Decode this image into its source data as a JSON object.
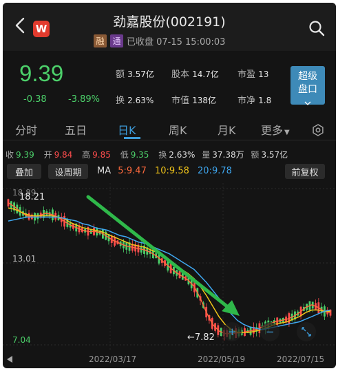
{
  "header": {
    "title": "劲嘉股份(002191)",
    "tag_margin": "融",
    "tag_connect": "通",
    "status": "已收盘 07-15 15:00:03",
    "app_logo": "W"
  },
  "quote": {
    "price": "9.39",
    "change": "-0.38",
    "change_pct": "-3.89%",
    "amount_label": "额",
    "amount": "3.57亿",
    "equity_label": "股本",
    "equity": "14.7亿",
    "pe_label": "市盈",
    "pe": "13",
    "turnover_label": "换",
    "turnover": "2.63%",
    "mcap_label": "市值",
    "mcap": "138亿",
    "pb_label": "市净",
    "pb": "1.8",
    "super_btn_line1": "超级",
    "super_btn_line2": "盘口"
  },
  "tabs": [
    {
      "label": "分时"
    },
    {
      "label": "五日"
    },
    {
      "label": "日K"
    },
    {
      "label": "周K"
    },
    {
      "label": "月K"
    },
    {
      "label": "更多"
    }
  ],
  "stats": {
    "close_label": "收",
    "close": "9.39",
    "open_label": "开",
    "open": "9.84",
    "high_label": "高",
    "high": "9.85",
    "low_label": "低",
    "low": "9.35",
    "turn_label": "换",
    "turn": "2.63%",
    "vol_label": "量",
    "vol": "37.38万",
    "amt_label": "额",
    "amt": "3.57亿"
  },
  "controls": {
    "overlay": "叠加",
    "period": "设周期",
    "adjust": "前复权"
  },
  "ma": {
    "label": "MA",
    "ma5": "5:9.47",
    "ma10": "10:9.58",
    "ma20": "20:9.78"
  },
  "colors": {
    "up": "#ff4d4d",
    "down": "#4cd06a",
    "ma5": "#ff6a3d",
    "ma10": "#f0c419",
    "ma20": "#3fa7f0",
    "accent": "#3d9bd9",
    "annotation_arrow": "#2fb84a"
  },
  "chart_data": {
    "type": "line",
    "y_ticks": [
      "13.01",
      "7.04"
    ],
    "x_ticks": [
      "2022/03/17",
      "2022/05/19",
      "2022/07/15"
    ],
    "high_label": "18.21",
    "low_label": "7.82",
    "top_clipped_label": "18.89",
    "ylim": [
      7.04,
      18.98
    ],
    "series": [
      {
        "name": "MA5",
        "values": [
          17.9,
          17.6,
          17.2,
          16.9,
          16.8,
          16.9,
          17.1,
          17.0,
          16.8,
          16.5,
          16.2,
          16.0,
          15.8,
          15.7,
          15.7,
          15.6,
          15.3,
          15.0,
          14.8,
          14.6,
          14.5,
          14.4,
          14.3,
          14.1,
          13.8,
          13.4,
          13.0,
          12.6,
          12.3,
          12.0,
          11.5,
          10.6,
          9.5,
          8.6,
          8.1,
          7.9,
          7.9,
          7.95,
          8.0,
          8.1,
          8.2,
          8.4,
          8.6,
          8.8,
          8.9,
          9.0,
          9.2,
          9.5,
          9.9,
          10.1,
          9.9,
          9.6,
          9.5
        ]
      },
      {
        "name": "MA10",
        "values": [
          17.5,
          17.4,
          17.2,
          17.0,
          16.9,
          16.9,
          16.9,
          16.9,
          16.8,
          16.7,
          16.4,
          16.2,
          16.0,
          15.9,
          15.8,
          15.7,
          15.5,
          15.3,
          15.1,
          14.9,
          14.7,
          14.6,
          14.5,
          14.3,
          14.1,
          13.8,
          13.5,
          13.1,
          12.8,
          12.5,
          12.1,
          11.5,
          10.8,
          10.0,
          9.2,
          8.6,
          8.2,
          8.0,
          8.0,
          8.0,
          8.1,
          8.2,
          8.4,
          8.6,
          8.7,
          8.8,
          9.0,
          9.2,
          9.5,
          9.7,
          9.7,
          9.6,
          9.6
        ]
      },
      {
        "name": "MA20",
        "values": [
          16.5,
          16.6,
          16.7,
          16.8,
          16.8,
          16.8,
          16.8,
          16.8,
          16.8,
          16.7,
          16.6,
          16.5,
          16.3,
          16.2,
          16.0,
          15.9,
          15.8,
          15.6,
          15.4,
          15.3,
          15.1,
          14.9,
          14.8,
          14.6,
          14.4,
          14.2,
          14.0,
          13.7,
          13.4,
          13.1,
          12.8,
          12.3,
          11.8,
          11.2,
          10.6,
          10.0,
          9.4,
          8.9,
          8.6,
          8.4,
          8.3,
          8.2,
          8.3,
          8.4,
          8.5,
          8.6,
          8.7,
          8.8,
          9.0,
          9.2,
          9.4,
          9.6,
          9.7
        ]
      }
    ]
  }
}
